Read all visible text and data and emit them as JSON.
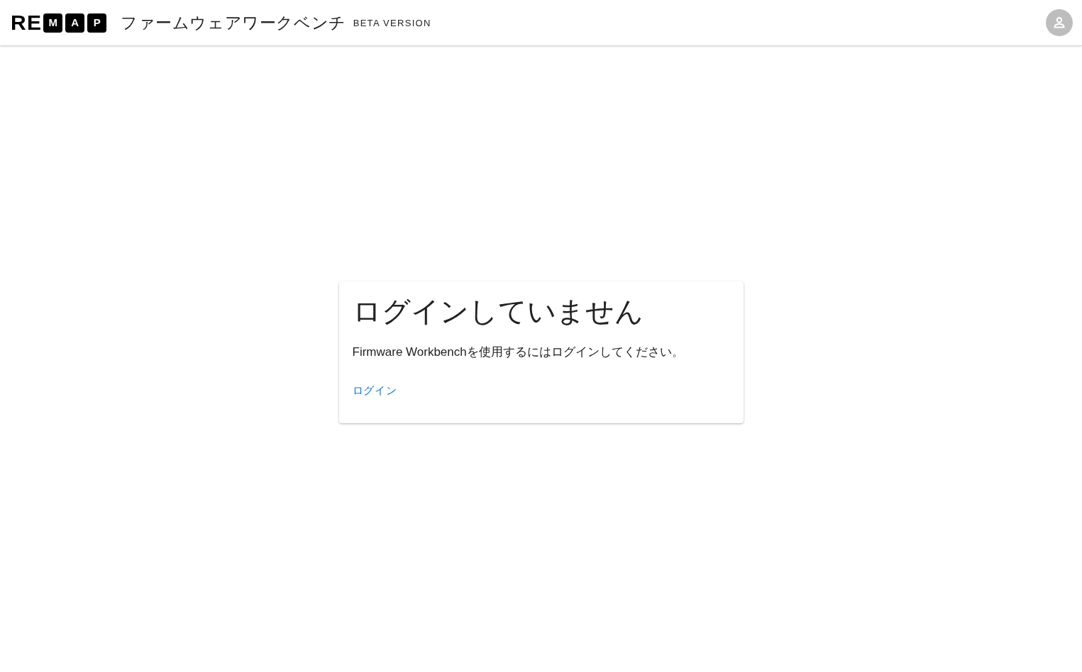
{
  "header": {
    "logo": {
      "plain": [
        "R",
        "E"
      ],
      "boxed": [
        "M",
        "A",
        "P"
      ]
    },
    "title": "ファームウェアワークベンチ",
    "badge": "BETA VERSION"
  },
  "card": {
    "heading": "ログインしていません",
    "message": "Firmware Workbenchを使用するにはログインしてください。",
    "link": "ログイン"
  }
}
